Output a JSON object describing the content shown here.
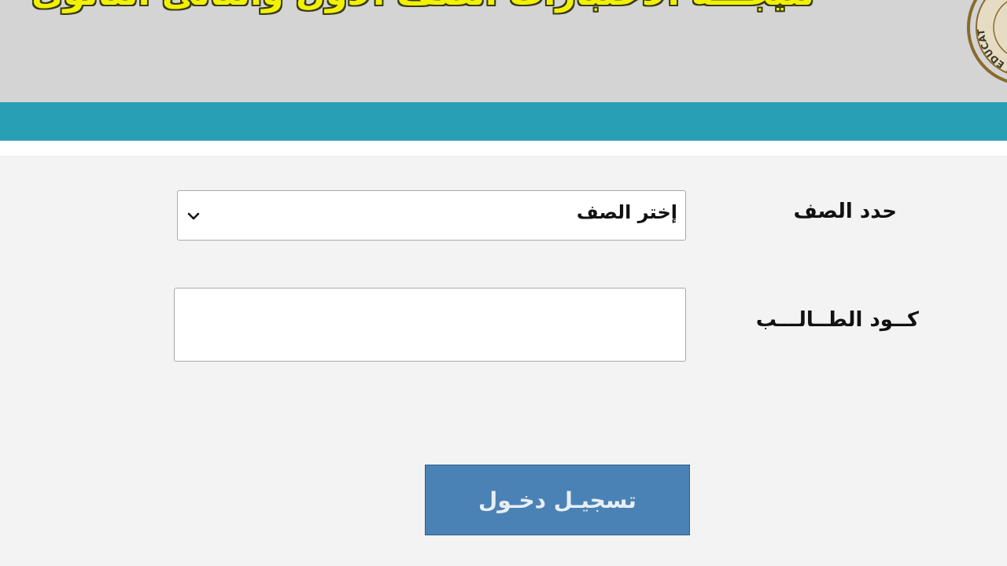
{
  "header": {
    "title": "نتيجـــة  الاختبارات الصف الأول والثانى الثانوى",
    "logo_icon": "ministry-seal-icon",
    "logo_text": "MINISTRY OF EDUCATION",
    "title_color": "#f2f200",
    "background_color": "#d4d4d4",
    "band_color": "#289fb5"
  },
  "form": {
    "class_label": "حدد الصف",
    "class_select": {
      "selected": "إختر الصف",
      "icon": "chevron-down-icon"
    },
    "code_label": "كــود الطــالـــب",
    "code_input": {
      "value": "",
      "placeholder": ""
    },
    "submit_label": "تسجيـل دخـول",
    "button_color": "#4a82b5"
  }
}
